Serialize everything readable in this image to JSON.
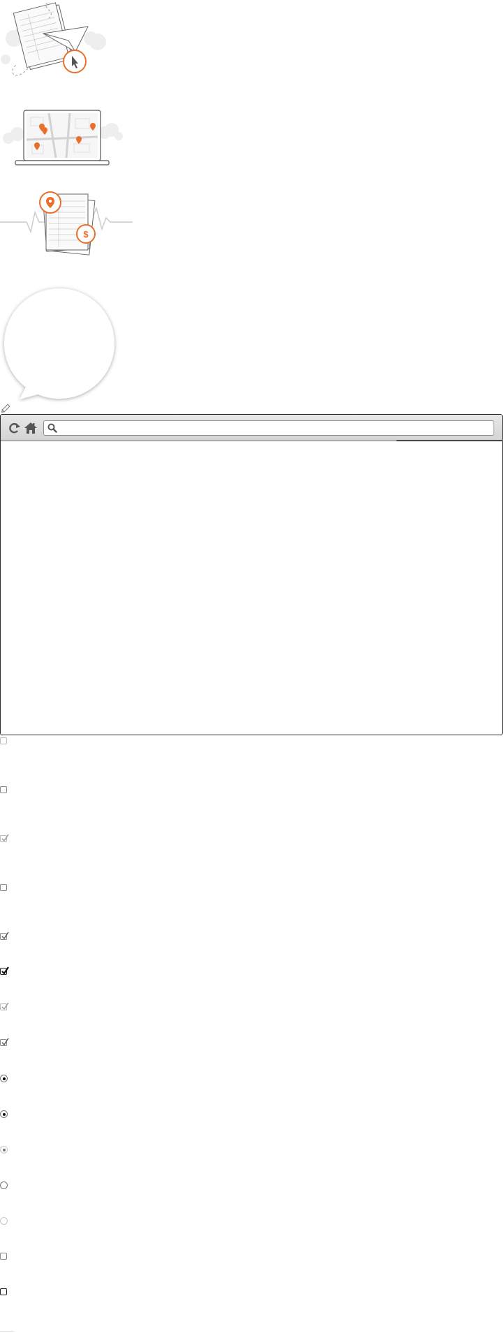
{
  "illustrations": [
    {
      "name": "paper-plane-document"
    },
    {
      "name": "laptop-map"
    },
    {
      "name": "documents-location-price"
    },
    {
      "name": "speech-bubble"
    }
  ],
  "browser": {
    "url": "",
    "buttons": [
      "reload-icon",
      "home-icon",
      "search-icon"
    ],
    "load_progress": 0.79
  },
  "controls": [
    {
      "type": "checkbox",
      "state": "unchecked",
      "style": "faint"
    },
    {
      "type": "checkbox",
      "state": "unchecked",
      "style": "normal"
    },
    {
      "type": "checkbox",
      "state": "checked",
      "style": "faint"
    },
    {
      "type": "checkbox",
      "state": "unchecked",
      "style": "normal"
    },
    {
      "type": "checkbox",
      "state": "checked",
      "style": "normal"
    },
    {
      "type": "checkbox",
      "state": "checked",
      "style": "bold"
    },
    {
      "type": "checkbox",
      "state": "checked",
      "style": "faint"
    },
    {
      "type": "checkbox",
      "state": "checked",
      "style": "normal"
    },
    {
      "type": "radio",
      "state": "selected",
      "style": "bold"
    },
    {
      "type": "radio",
      "state": "selected",
      "style": "normal"
    },
    {
      "type": "radio",
      "state": "selected",
      "style": "faint"
    },
    {
      "type": "radio",
      "state": "unselected",
      "style": "normal"
    },
    {
      "type": "radio",
      "state": "unselected",
      "style": "faint"
    },
    {
      "type": "checkbox",
      "state": "unchecked",
      "style": "normal"
    },
    {
      "type": "checkbox",
      "state": "unchecked",
      "style": "bold"
    }
  ]
}
